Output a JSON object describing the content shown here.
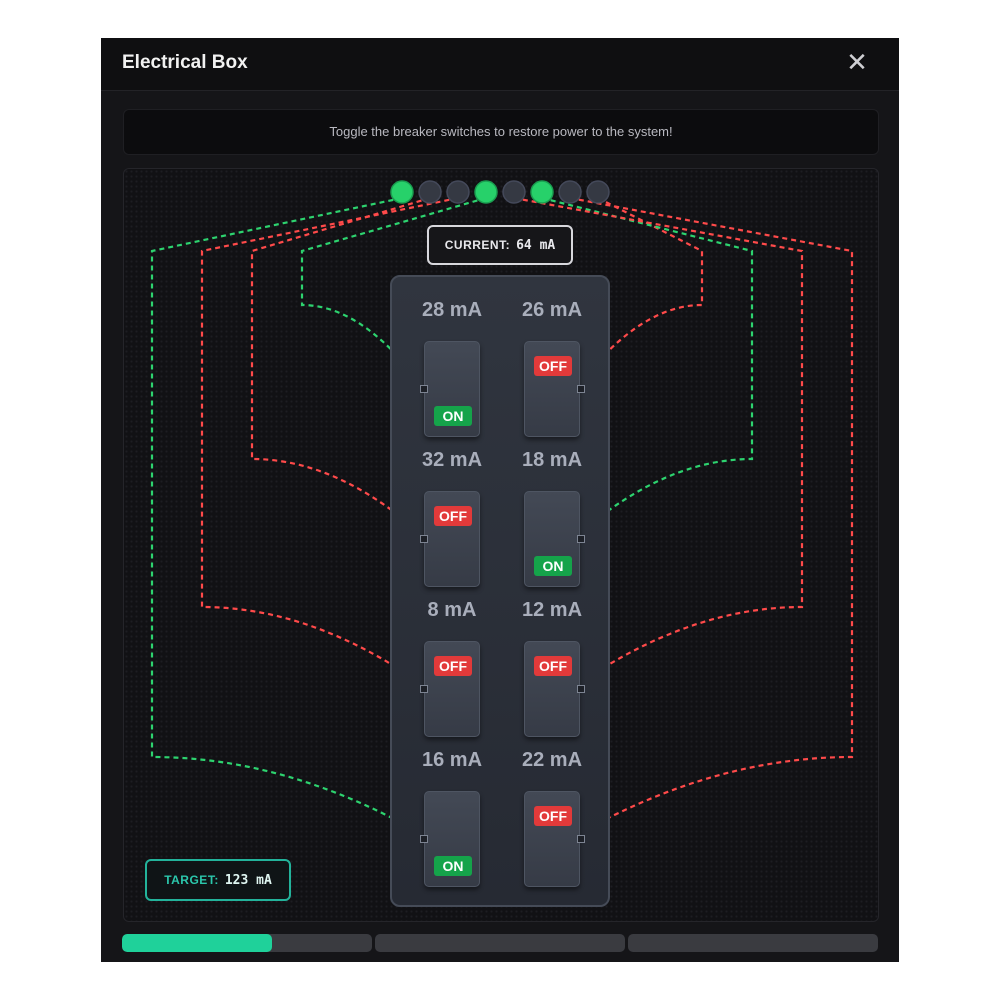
{
  "window": {
    "title": "Electrical Box",
    "close_icon": "close-icon"
  },
  "instruction": "Toggle the breaker switches to restore power to the system!",
  "current": {
    "label": "CURRENT:",
    "value": "64 mA"
  },
  "target": {
    "label": "TARGET:",
    "value": "123 mA"
  },
  "indicators": [
    true,
    false,
    false,
    true,
    false,
    true,
    false,
    false
  ],
  "breakers": [
    {
      "amps": "28 mA",
      "state": "ON",
      "on": true
    },
    {
      "amps": "26 mA",
      "state": "OFF",
      "on": false
    },
    {
      "amps": "32 mA",
      "state": "OFF",
      "on": false
    },
    {
      "amps": "18 mA",
      "state": "ON",
      "on": true
    },
    {
      "amps": "8 mA",
      "state": "OFF",
      "on": false
    },
    {
      "amps": "12 mA",
      "state": "OFF",
      "on": false
    },
    {
      "amps": "16 mA",
      "state": "ON",
      "on": true
    },
    {
      "amps": "22 mA",
      "state": "OFF",
      "on": false
    }
  ],
  "progress": [
    0.6,
    0,
    0
  ],
  "colors": {
    "on": "#2dd36f",
    "off": "#ff4a4a",
    "indicator_on": "#27d16a",
    "indicator_off": "#353943",
    "progress": "#1fd19a",
    "target": "#23b39b"
  }
}
